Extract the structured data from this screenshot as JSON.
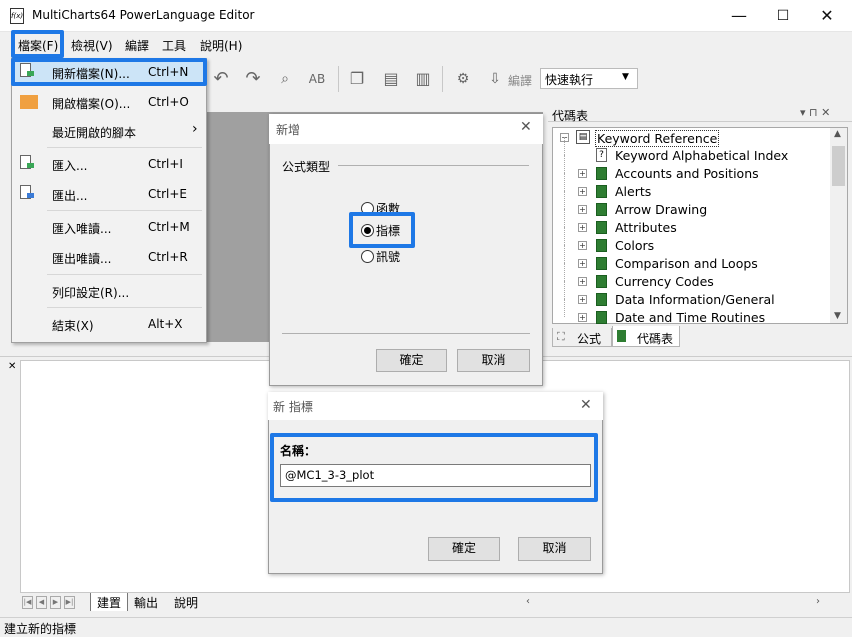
{
  "window": {
    "title": "MultiCharts64 PowerLanguage Editor",
    "app_icon_text": "f(x)",
    "min": "—",
    "max": "☐",
    "close": "✕"
  },
  "menubar": {
    "items": [
      "檔案(F)",
      "檢視(V)",
      "編譯",
      "工具",
      "說明(H)"
    ],
    "accent": "#1e78e6"
  },
  "toolbar": {
    "compile_label": "編譯",
    "quick_exec": "快速執行"
  },
  "file_menu": {
    "items": [
      {
        "label": "開新檔案(N)...",
        "shortcut": "Ctrl+N"
      },
      {
        "label": "開啟檔案(O)...",
        "shortcut": "Ctrl+O"
      },
      {
        "label": "最近開啟的腳本",
        "shortcut": ""
      },
      {
        "label": "匯入...",
        "shortcut": "Ctrl+I"
      },
      {
        "label": "匯出...",
        "shortcut": "Ctrl+E"
      },
      {
        "label": "匯入唯讀...",
        "shortcut": "Ctrl+M"
      },
      {
        "label": "匯出唯讀...",
        "shortcut": "Ctrl+R"
      },
      {
        "label": "列印設定(R)...",
        "shortcut": ""
      },
      {
        "label": "結束(X)",
        "shortcut": "Alt+X"
      }
    ],
    "submenu_arrow": "›"
  },
  "code_panel": {
    "title": "代碼表",
    "buttons": "▾ ⊓ ✕",
    "root": "Keyword Reference",
    "items": [
      "Keyword Alphabetical Index",
      "Accounts and Positions",
      "Alerts",
      "Arrow Drawing",
      "Attributes",
      "Colors",
      "Comparison and Loops",
      "Currency Codes",
      "Data Information/General",
      "Date and Time Routines"
    ],
    "tabs": [
      "公式",
      "代碼表"
    ]
  },
  "new_dialog": {
    "title": "新增",
    "section": "公式類型",
    "options": [
      "函數",
      "指標",
      "訊號"
    ],
    "selected": "指標",
    "ok": "確定",
    "cancel": "取消"
  },
  "name_dialog": {
    "title": "新 指標",
    "name_label": "名稱：",
    "name_value": "@MC1_3-3_plot",
    "ok": "確定",
    "cancel": "取消"
  },
  "output": {
    "tabs": [
      "建置",
      "輸出",
      "說明"
    ]
  },
  "status": {
    "text": "建立新的指標"
  }
}
